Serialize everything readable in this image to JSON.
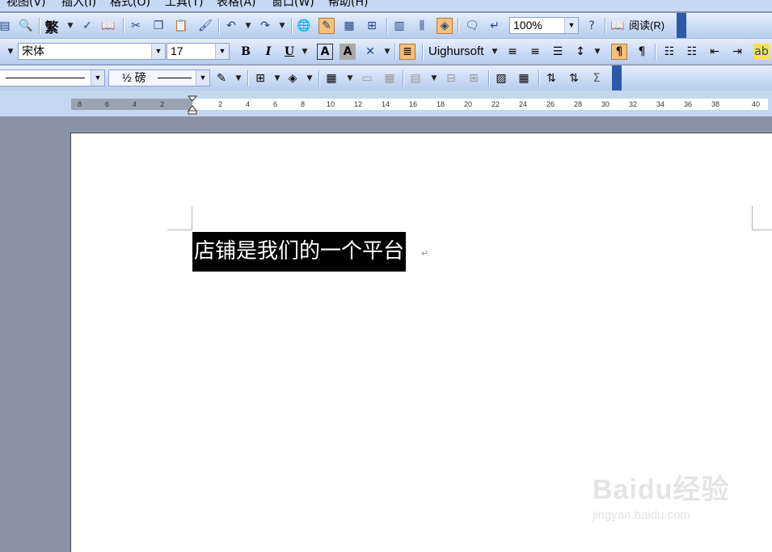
{
  "menu": [
    "视图(V)",
    "插入(I)",
    "格式(O)",
    "工具(T)",
    "表格(A)",
    "窗口(W)",
    "帮助(H)"
  ],
  "standard_toolbar": {
    "trad_chinese": "繁",
    "zoom": "100%",
    "read_label": "阅读(R)"
  },
  "format_toolbar": {
    "style": "",
    "font": "宋体",
    "size": "17",
    "bold": "B",
    "italic": "I",
    "underline": "U",
    "char_border": "A",
    "char_shading": "A",
    "uighur_font": "Uighursoft"
  },
  "tables_toolbar": {
    "line_weight": "½ 磅",
    "sum": "Σ"
  },
  "ruler": {
    "left_labels": [
      "8",
      "6",
      "4",
      "2"
    ],
    "right_labels": [
      "2",
      "4",
      "6",
      "8",
      "10",
      "12",
      "14",
      "16",
      "18",
      "20",
      "22",
      "24",
      "26",
      "28",
      "30",
      "32",
      "34",
      "36",
      "38",
      "40"
    ]
  },
  "document": {
    "selected_text": "店铺是我们的一个平台",
    "paragraph_mark": "↵"
  },
  "watermark": {
    "brand": "Baidu经验",
    "url": "jingyan.baidu.com"
  },
  "colors": {
    "toolbar_bg": "#c9dbf5",
    "highlight_button": "#f7c07a",
    "selection": "#000000",
    "workspace": "#8a93a6"
  }
}
